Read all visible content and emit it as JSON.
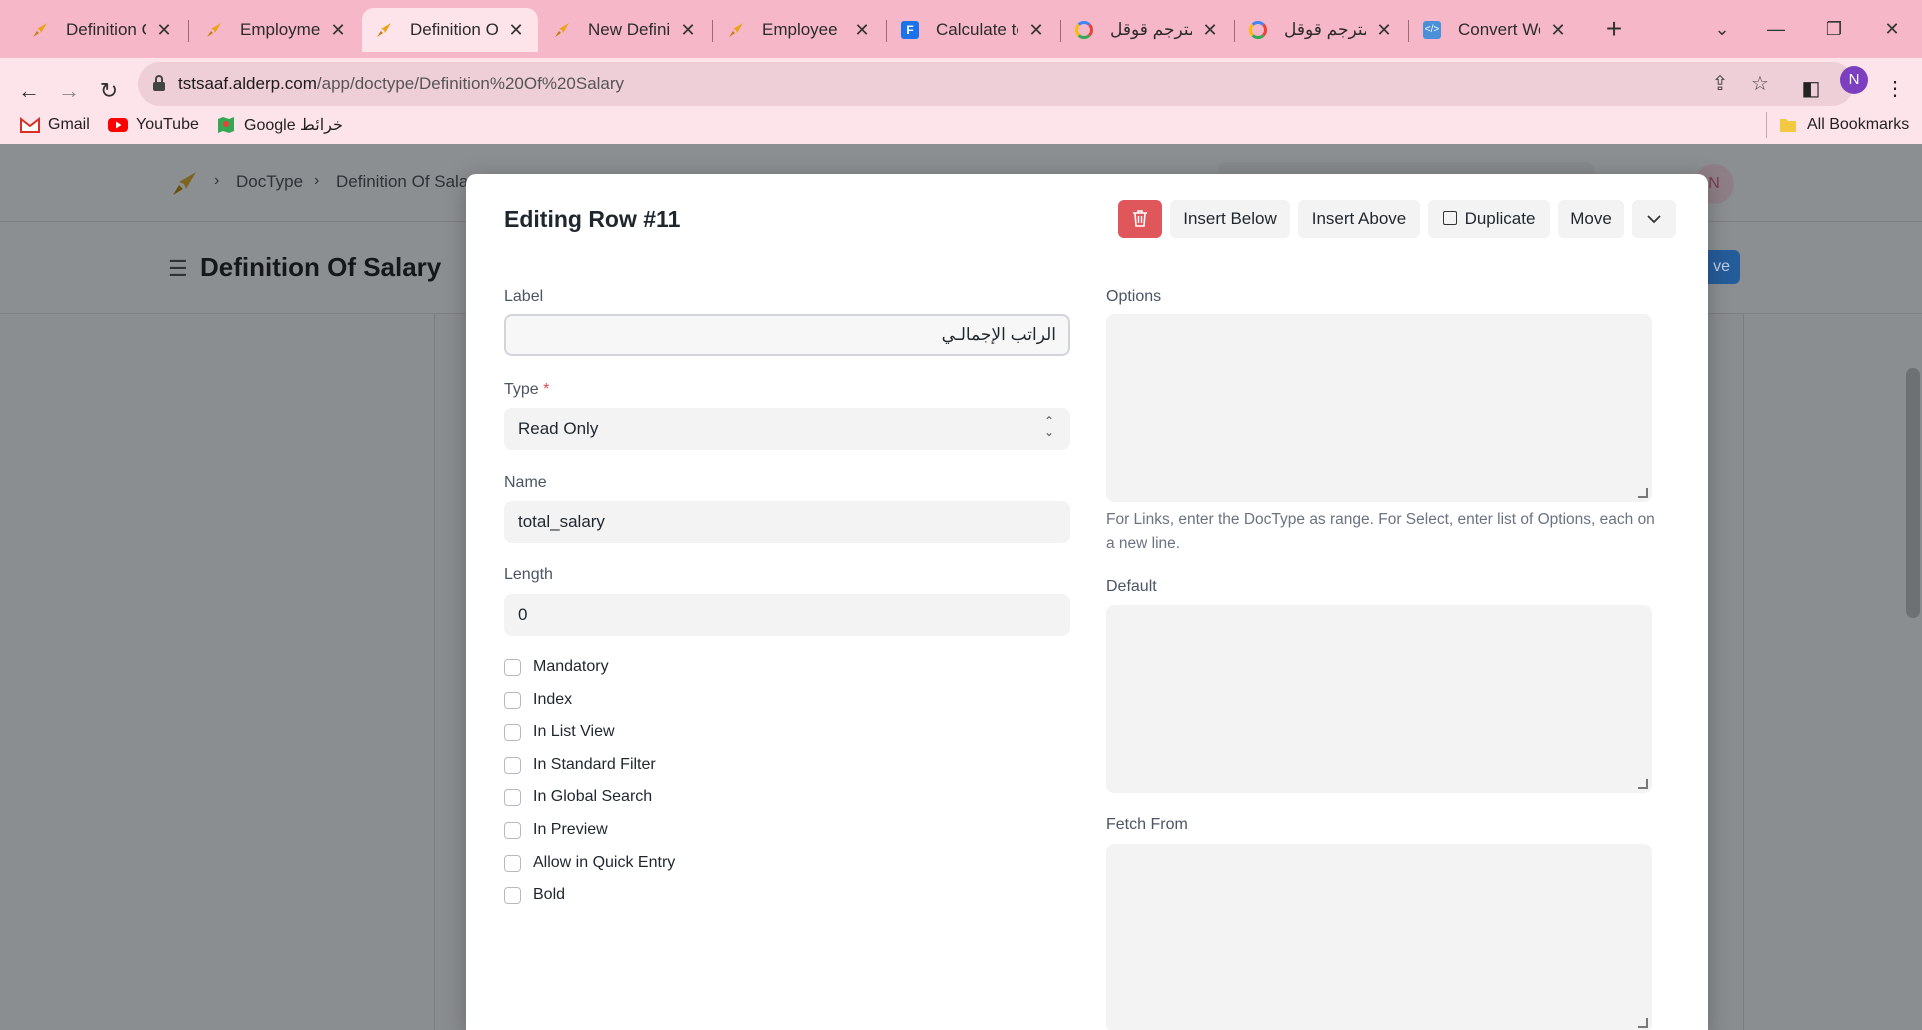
{
  "browser": {
    "tabs": [
      {
        "title": "Definition Of",
        "icon": "rocket-icon"
      },
      {
        "title": "Employment",
        "icon": "rocket-icon"
      },
      {
        "title": "Definition Of",
        "icon": "rocket-icon",
        "active": true
      },
      {
        "title": "New Definitio",
        "icon": "rocket-icon"
      },
      {
        "title": "Employee",
        "icon": "rocket-icon"
      },
      {
        "title": "Calculate tota",
        "icon": "forms-icon"
      },
      {
        "title": "مترجم قوقل -",
        "icon": "google-icon"
      },
      {
        "title": "مترجم قوقل -",
        "icon": "google-icon"
      },
      {
        "title": "Convert Wor",
        "icon": "code-icon"
      }
    ],
    "url_host": "tstsaaf.alderp.com",
    "url_path": "/app/doctype/Definition%20Of%20Salary",
    "profile_initial": "N",
    "bookmarks": [
      {
        "label": "Gmail",
        "icon": "gmail-icon"
      },
      {
        "label": "YouTube",
        "icon": "youtube-icon"
      },
      {
        "label": "Google خرائط",
        "icon": "maps-icon"
      }
    ],
    "all_bookmarks": "All Bookmarks"
  },
  "app": {
    "breadcrumb": [
      "DocType",
      "Definition Of Sala"
    ],
    "page_title": "Definition Of Salary",
    "avatar_initial": "N",
    "save_label": "ve"
  },
  "modal": {
    "title": "Editing Row #11",
    "buttons": {
      "insert_below": "Insert Below",
      "insert_above": "Insert Above",
      "duplicate": "Duplicate",
      "move": "Move"
    },
    "fields": {
      "label": {
        "label": "Label",
        "value": "الراتب الإجمالـي"
      },
      "type": {
        "label": "Type",
        "required_mark": "*",
        "value": "Read Only"
      },
      "name": {
        "label": "Name",
        "value": "total_salary"
      },
      "length": {
        "label": "Length",
        "value": "0"
      },
      "options": {
        "label": "Options",
        "value": "",
        "help": "For Links, enter the DocType as range. For Select, enter list of Options, each on a new line."
      },
      "default": {
        "label": "Default",
        "value": ""
      },
      "fetch_from": {
        "label": "Fetch From",
        "value": ""
      }
    },
    "checkboxes": [
      {
        "label": "Mandatory",
        "checked": false
      },
      {
        "label": "Index",
        "checked": false
      },
      {
        "label": "In List View",
        "checked": false
      },
      {
        "label": "In Standard Filter",
        "checked": false
      },
      {
        "label": "In Global Search",
        "checked": false
      },
      {
        "label": "In Preview",
        "checked": false
      },
      {
        "label": "Allow in Quick Entry",
        "checked": false
      },
      {
        "label": "Bold",
        "checked": false
      }
    ]
  },
  "colors": {
    "tabbar": "#f6b8c8",
    "toolbar": "#fde4ea",
    "delete_button": "#e0575b",
    "primary": "#255c9a"
  }
}
